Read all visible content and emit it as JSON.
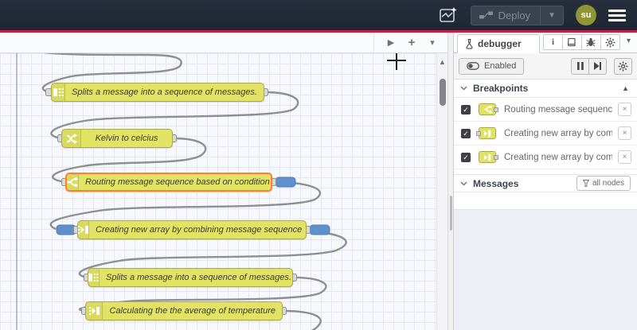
{
  "header": {
    "deploy_label": "Deploy",
    "avatar_text": "su"
  },
  "colors": {
    "header_bg": "#232a38",
    "accent_red": "#c32148",
    "node_fill": "#e2e364",
    "node_border": "#a9a94d",
    "selected_border": "#ff7f2a",
    "breakpoint_blue": "#6090cc",
    "wire_gray": "#8f8f8f",
    "avatar_olive": "#8f9435"
  },
  "icons": {
    "scroll_play": "▶",
    "add": "+",
    "caret_down": "▾",
    "scroll_up": "▲",
    "close": "×",
    "check": "✓",
    "info": "i"
  },
  "canvas": {
    "nodes": [
      {
        "label": "Splits a message into a sequence of messages.",
        "icon": "split"
      },
      {
        "label": "Kelvin to celcius",
        "icon": "change"
      },
      {
        "label": "Routing message sequence based on condition",
        "icon": "switch",
        "selected": true
      },
      {
        "label": "Creating new array by combining message sequence",
        "icon": "join"
      },
      {
        "label": "Splits a message into a sequence of messages.",
        "icon": "split"
      },
      {
        "label": "Calculating the the average of temperature",
        "icon": "join"
      }
    ]
  },
  "sidebar": {
    "tab_label": "debugger",
    "toolbar": {
      "enabled_label": "Enabled"
    },
    "breakpoints": {
      "title": "Breakpoints",
      "items": [
        {
          "label": "Routing message sequence ba",
          "checked": true,
          "icon": "switch",
          "port": "right"
        },
        {
          "label": "Creating new array by combini",
          "checked": true,
          "icon": "join",
          "port": "left"
        },
        {
          "label": "Creating new array by combini",
          "checked": true,
          "icon": "join",
          "port": "right"
        }
      ]
    },
    "messages": {
      "title": "Messages",
      "filter_label": "all nodes"
    }
  }
}
